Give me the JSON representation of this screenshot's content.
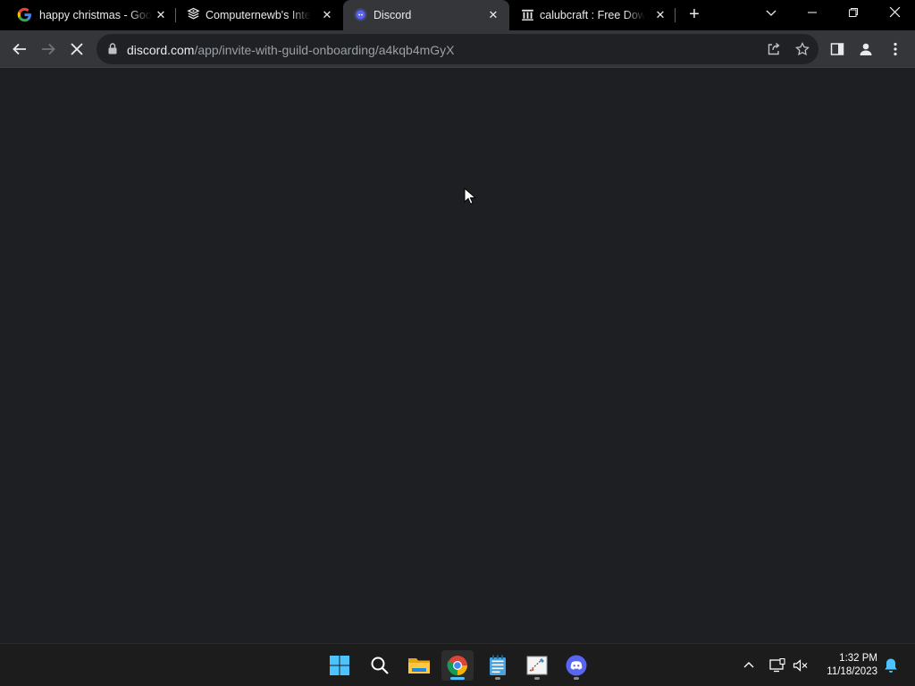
{
  "browser": {
    "tabs": [
      {
        "title": "happy christmas - Google Search",
        "favicon": "google-icon",
        "active": false
      },
      {
        "title": "Computernewb's Internet Archive",
        "favicon": "computernewb-icon",
        "active": false
      },
      {
        "title": "Discord",
        "favicon": "discord-icon",
        "active": true
      },
      {
        "title": "calubcraft : Free Download",
        "favicon": "archive-icon",
        "active": false
      }
    ],
    "new_tab": "+",
    "url": {
      "host": "discord.com",
      "path": "/app/invite-with-guild-onboarding/a4kqb4mGyX"
    }
  },
  "taskbar": {
    "apps": [
      "start-icon",
      "search-icon",
      "file-explorer-icon",
      "chrome-icon",
      "notepad-icon",
      "paint-icon",
      "discord-icon"
    ],
    "clock": {
      "time": "1:32 PM",
      "date": "11/18/2023"
    }
  },
  "colors": {
    "tabstrip": "#000000",
    "toolbar": "#35363a",
    "page_bg": "#1e1f22",
    "taskbar": "#1c1c1c",
    "accent": "#4cc2ff",
    "discord": "#5865f2"
  }
}
